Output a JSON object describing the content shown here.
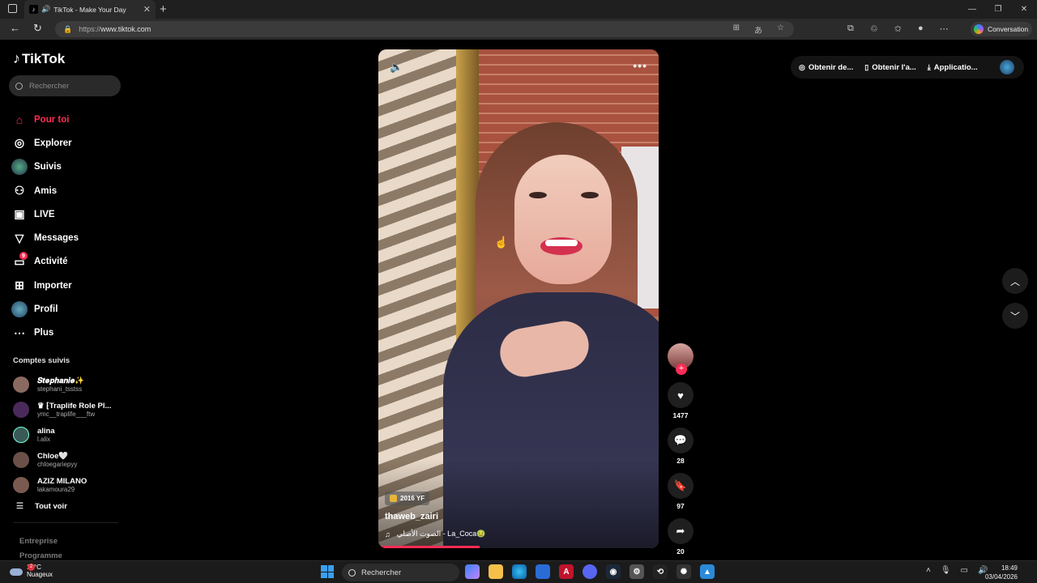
{
  "browser": {
    "tab_title": "TikTok - Make Your Day",
    "url_proto": "https://",
    "url_host": "www.tiktok.com",
    "conversation_label": "Conversation"
  },
  "sidebar": {
    "logo": "TikTok",
    "search_placeholder": "Rechercher",
    "nav": [
      {
        "label": "Pour toi",
        "icon": "home-icon"
      },
      {
        "label": "Explorer",
        "icon": "compass-icon"
      },
      {
        "label": "Suivis",
        "icon": "following-avatar-icon"
      },
      {
        "label": "Amis",
        "icon": "friends-icon"
      },
      {
        "label": "LIVE",
        "icon": "live-icon"
      },
      {
        "label": "Messages",
        "icon": "send-icon"
      },
      {
        "label": "Activité",
        "icon": "activity-icon",
        "badge": "9"
      },
      {
        "label": "Importer",
        "icon": "upload-icon"
      },
      {
        "label": "Profil",
        "icon": "profile-avatar-icon"
      },
      {
        "label": "Plus",
        "icon": "more-icon"
      }
    ],
    "following_title": "Comptes suivis",
    "following": [
      {
        "name": "𝑺𝒕𝒆𝒑𝒉𝒂𝒏𝒊𝒆✨",
        "handle": "stephani_tsstss"
      },
      {
        "name": "♛ ⁅Traplife Role Pl...",
        "handle": "ymc__traplife___ftw"
      },
      {
        "name": "alina",
        "handle": "l.alix"
      },
      {
        "name": "Chloe🤍",
        "handle": "chloegariepyy"
      },
      {
        "name": "AZIZ MILANO",
        "handle": "lakamoura29"
      }
    ],
    "see_all": "Tout voir",
    "footer_1": "Entreprise",
    "footer_2": "Programme"
  },
  "video": {
    "tag": "2016 YF",
    "author": "thaweb_zairi",
    "sound": "الصوت الأصلي - La_Coca🤢",
    "progress": 0.36
  },
  "actions": {
    "likes": "1477",
    "comments": "28",
    "saves": "97",
    "shares": "20"
  },
  "topright": {
    "item1": "Obtenir de...",
    "item2": "Obtenir l'a...",
    "item3": "Applicatio..."
  },
  "taskbar": {
    "temp": "14°C",
    "weather": "Nuageux",
    "weather_badge": "2",
    "search": "Rechercher",
    "time": "18:49",
    "date": "03/04/2026"
  }
}
